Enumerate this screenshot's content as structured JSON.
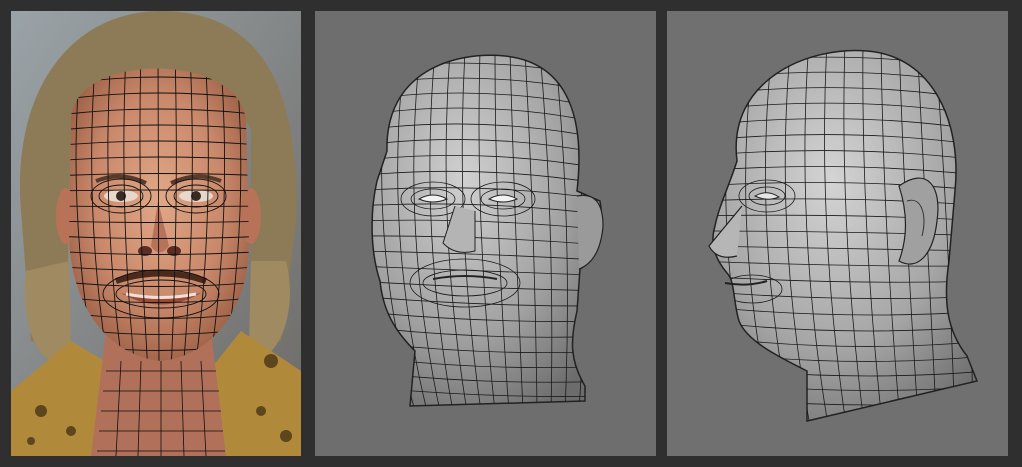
{
  "scene": {
    "description_free": true,
    "panels": [
      {
        "kind": "photo-with-wireframe-overlay"
      },
      {
        "kind": "rendered-mesh-three-quarter"
      },
      {
        "kind": "rendered-mesh-side"
      }
    ]
  },
  "colors": {
    "frame": "#2f2f2f",
    "viewport": "#6e6e6e",
    "skin": "#c9896a",
    "mesh_fill": "#a7a7a7",
    "wire": "#111111",
    "hair": "#8c7a5a"
  }
}
